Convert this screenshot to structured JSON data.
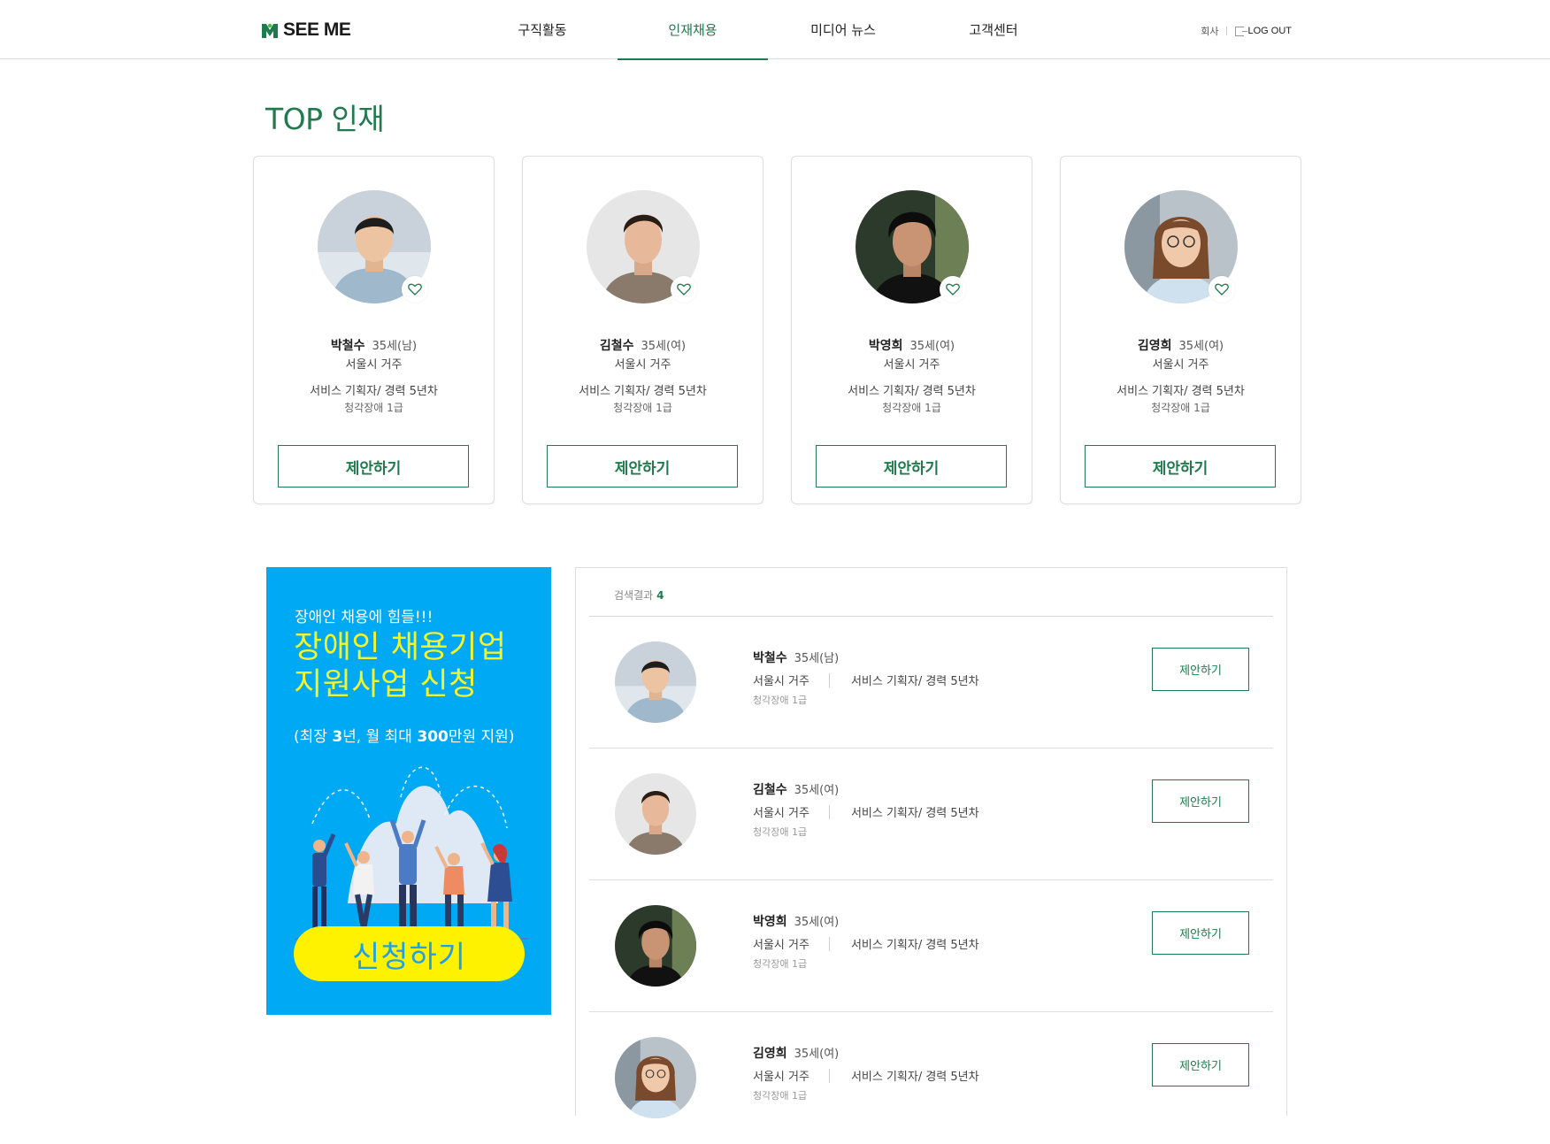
{
  "header": {
    "logo_text": "SEE ME",
    "nav": [
      "구직활동",
      "인재채용",
      "미디어 뉴스",
      "고객센터"
    ],
    "active_nav": 1,
    "util_company": "회사",
    "logout_label": "LOG OUT"
  },
  "section_title": "TOP 인재",
  "cards": [
    {
      "name": "박철수",
      "age": "35세(남)",
      "location": "서울시 거주",
      "career": "서비스 기획자/ 경력 5년차",
      "disability": "청각장애 1급",
      "button": "제안하기"
    },
    {
      "name": "김철수",
      "age": "35세(여)",
      "location": "서울시 거주",
      "career": "서비스 기획자/ 경력 5년차",
      "disability": "청각장애 1급",
      "button": "제안하기"
    },
    {
      "name": "박영희",
      "age": "35세(여)",
      "location": "서울시 거주",
      "career": "서비스 기획자/ 경력 5년차",
      "disability": "청각장애 1급",
      "button": "제안하기"
    },
    {
      "name": "김영희",
      "age": "35세(여)",
      "location": "서울시 거주",
      "career": "서비스 기획자/ 경력 5년차",
      "disability": "청각장애 1급",
      "button": "제안하기"
    }
  ],
  "banner": {
    "sub": "장애인 채용에 힘들!!!",
    "title_line1": "장애인 채용기업",
    "title_line2": "지원사업 신청",
    "note_pre": "(최장 ",
    "note_years": "3",
    "note_mid": "년, 월 최대 ",
    "note_amount": "300",
    "note_post": "만원 지원)",
    "apply_label": "신청하기"
  },
  "results": {
    "label": "검색결과",
    "count": "4",
    "rows": [
      {
        "name": "박철수",
        "age": "35세(남)",
        "location": "서울시 거주",
        "career": "서비스 기획자/ 경력 5년차",
        "disability": "청각장애 1급",
        "button": "제안하기"
      },
      {
        "name": "김철수",
        "age": "35세(여)",
        "location": "서울시 거주",
        "career": "서비스 기획자/ 경력 5년차",
        "disability": "청각장애 1급",
        "button": "제안하기"
      },
      {
        "name": "박영희",
        "age": "35세(여)",
        "location": "서울시 거주",
        "career": "서비스 기획자/ 경력 5년차",
        "disability": "청각장애 1급",
        "button": "제안하기"
      },
      {
        "name": "김영희",
        "age": "35세(여)",
        "location": "서울시 거주",
        "career": "서비스 기획자/ 경력 5년차",
        "disability": "청각장애 1급",
        "button": "제안하기"
      }
    ]
  },
  "colors": {
    "brand_green": "#1f7a4d",
    "banner_blue": "#00a9f4",
    "banner_yellow": "#fff200"
  }
}
